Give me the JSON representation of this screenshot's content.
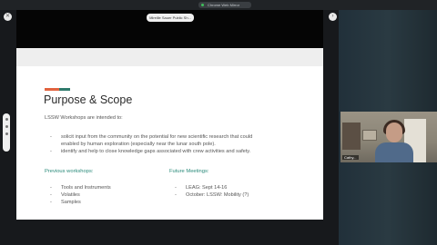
{
  "window": {
    "tab_label": "Chrome Web Mirror"
  },
  "meeting": {
    "presenter_pill": "Mireille Sauer Public Sh..."
  },
  "slide": {
    "title": "Purpose & Scope",
    "intro": "LSSW Workshops are intended to:",
    "bullets": [
      "solicit input from the community on the potential for new scientific research that could",
      "enabled by human exploration (especially near the lunar south pole).",
      "identify and help to close knowledge gaps associated with crew activities and safety."
    ],
    "previous": {
      "heading": "Previous workshops:",
      "items": [
        "Tools and Instruments",
        "Volatiles",
        "Samples"
      ]
    },
    "future": {
      "heading": "Future Meetings:",
      "items": [
        "LEAG: Sept 14-16",
        "October: LSSW: Mobility (?)"
      ]
    },
    "accent_colors": [
      "#e1633f",
      "#2f7a6c"
    ]
  },
  "camera": {
    "name_label": "Cathy..."
  },
  "icons": {
    "close": "close-icon",
    "chevron": "chevron-right-icon"
  }
}
